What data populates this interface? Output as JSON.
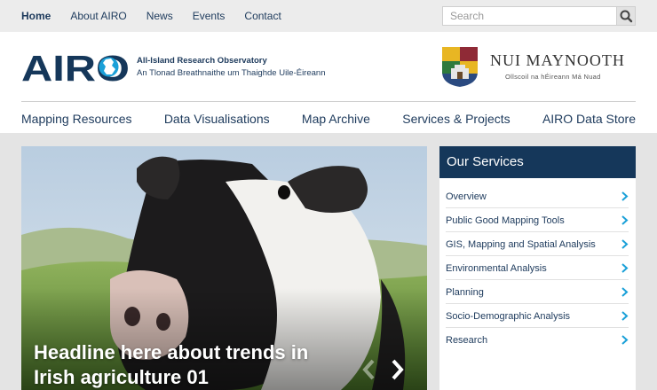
{
  "top_nav": [
    "Home",
    "About AIRO",
    "News",
    "Events",
    "Contact"
  ],
  "search": {
    "placeholder": "Search"
  },
  "brand": {
    "logo_text": "AIRO",
    "tagline_en": "All-Island Research Observatory",
    "tagline_ga": "An Tlonad Breathnaithe um Thaighde Uile-Éireann",
    "university": "NUI MAYNOOTH",
    "university_sub": "Ollscoil na hÉireann Má Nuad"
  },
  "main_nav": [
    "Mapping Resources",
    "Data Visualisations",
    "Map Archive",
    "Services & Projects",
    "AIRO Data Store"
  ],
  "hero": {
    "headline": "Headline here about trends in Irish agriculture 01"
  },
  "services": {
    "title": "Our Services",
    "items": [
      "Overview",
      "Public Good Mapping Tools",
      "GIS, Mapping and Spatial Analysis",
      "Environmental Analysis",
      "Planning",
      "Socio-Demographic Analysis",
      "Research"
    ]
  },
  "colors": {
    "navy": "#15375a",
    "link": "#1d3a5c",
    "accent": "#1aa0d8"
  }
}
